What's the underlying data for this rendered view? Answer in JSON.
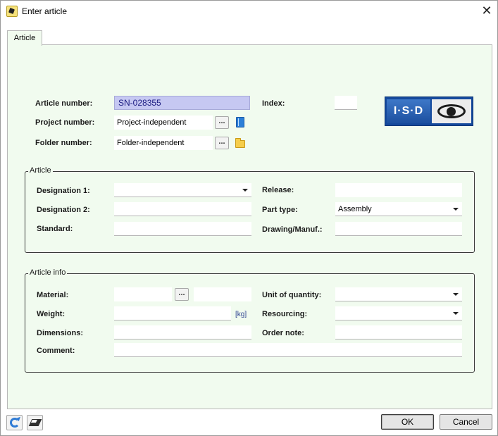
{
  "window": {
    "title": "Enter article"
  },
  "tabs": [
    {
      "label": "Article"
    }
  ],
  "header": {
    "article_number_label": "Article number:",
    "article_number_value": "SN-028355",
    "index_label": "Index:",
    "index_value": "",
    "project_number_label": "Project number:",
    "project_number_value": "Project-independent",
    "folder_number_label": "Folder number:",
    "folder_number_value": "Folder-independent",
    "browse_label": "...",
    "logo_text": "I·S·D"
  },
  "article_group": {
    "title": "Article",
    "designation1_label": "Designation 1:",
    "designation1_value": "",
    "designation2_label": "Designation 2:",
    "designation2_value": "",
    "standard_label": "Standard:",
    "standard_value": "",
    "release_label": "Release:",
    "release_value": "",
    "part_type_label": "Part type:",
    "part_type_value": "Assembly",
    "drawing_label": "Drawing/Manuf.:",
    "drawing_value": ""
  },
  "info_group": {
    "title": "Article info",
    "material_label": "Material:",
    "material_value": "",
    "material_extra": "",
    "material_browse": "...",
    "weight_label": "Weight:",
    "weight_value": "",
    "weight_unit": "[kg]",
    "dimensions_label": "Dimensions:",
    "dimensions_value": "",
    "comment_label": "Comment:",
    "comment_value": "",
    "unit_qty_label": "Unit of quantity:",
    "unit_qty_value": "",
    "resourcing_label": "Resourcing:",
    "resourcing_value": "",
    "order_note_label": "Order note:",
    "order_note_value": ""
  },
  "footer": {
    "ok_label": "OK",
    "cancel_label": "Cancel"
  },
  "icons": {
    "app": "isd-app-icon",
    "close": "close-icon",
    "project": "book-icon",
    "folder": "folder-icon",
    "refresh": "refresh-icon",
    "eraser": "eraser-icon"
  },
  "colors": {
    "panel_bg": "#f1fbef",
    "selection_bg": "#c6c8f2",
    "logo_blue": "#15499c"
  }
}
